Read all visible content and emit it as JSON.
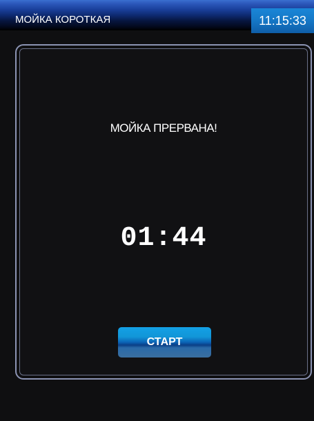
{
  "header": {
    "title": "МОЙКА КОРОТКАЯ",
    "clock": "11:15:33"
  },
  "main": {
    "status_message": "МОЙКА ПРЕРВАНА!",
    "timer": "01:44",
    "start_label": "СТАРТ"
  },
  "colors": {
    "accent": "#1577c6",
    "background": "#0f0f11",
    "panel_border": "#8c94b4",
    "text": "#ffffff"
  }
}
